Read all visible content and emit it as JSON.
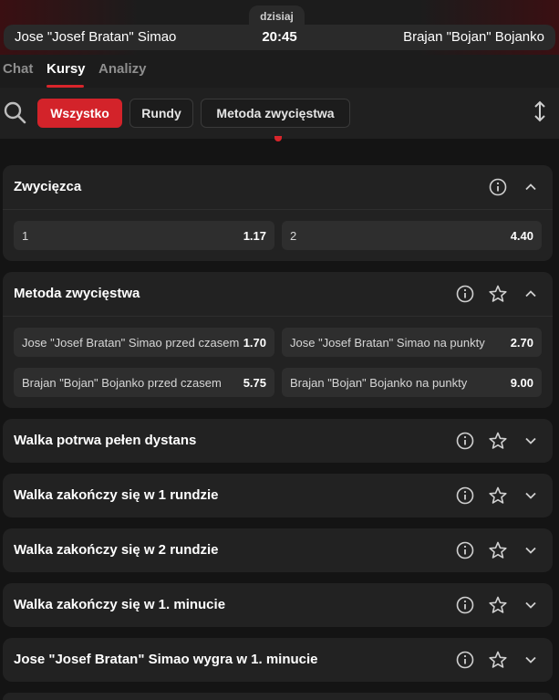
{
  "match": {
    "day_label": "dzisiaj",
    "home": "Jose \"Josef Bratan\" Simao",
    "time": "20:45",
    "away": "Brajan \"Bojan\" Bojanko"
  },
  "tabs": [
    {
      "label": "Chat",
      "active": false
    },
    {
      "label": "Kursy",
      "active": true
    },
    {
      "label": "Analizy",
      "active": false
    }
  ],
  "filters": [
    {
      "label": "Wszystko",
      "active": true
    },
    {
      "label": "Rundy",
      "active": false
    },
    {
      "label": "Metoda zwycięstwa",
      "active": false
    }
  ],
  "markets": [
    {
      "title": "Zwycięzca",
      "expanded": true,
      "favorite_icon": false,
      "odds": [
        {
          "label": "1",
          "value": "1.17"
        },
        {
          "label": "2",
          "value": "4.40"
        }
      ]
    },
    {
      "title": "Metoda zwycięstwa",
      "expanded": true,
      "favorite_icon": true,
      "odds": [
        {
          "label": "Jose \"Josef Bratan\" Simao przed czasem",
          "value": "1.70"
        },
        {
          "label": "Jose \"Josef Bratan\" Simao na punkty",
          "value": "2.70"
        },
        {
          "label": "Brajan \"Bojan\" Bojanko przed czasem",
          "value": "5.75"
        },
        {
          "label": "Brajan \"Bojan\" Bojanko na punkty",
          "value": "9.00"
        }
      ]
    },
    {
      "title": "Walka potrwa pełen dystans",
      "expanded": false,
      "favorite_icon": true
    },
    {
      "title": "Walka zakończy się w 1 rundzie",
      "expanded": false,
      "favorite_icon": true
    },
    {
      "title": "Walka zakończy się w 2 rundzie",
      "expanded": false,
      "favorite_icon": true
    },
    {
      "title": "Walka zakończy się w 1. minucie",
      "expanded": false,
      "favorite_icon": true
    },
    {
      "title": "Jose \"Josef Bratan\" Simao wygra w 1. minucie",
      "expanded": false,
      "favorite_icon": true
    }
  ],
  "colors": {
    "accent": "#d3232a",
    "background": "#141414",
    "card": "#222222",
    "odd_cell": "#2e2e2e"
  },
  "icons": {
    "search": "search-icon",
    "sort": "sort-arrows-icon",
    "info": "info-icon",
    "favorite": "star-icon",
    "collapse": "chevron-up-icon",
    "expand": "chevron-down-icon"
  }
}
